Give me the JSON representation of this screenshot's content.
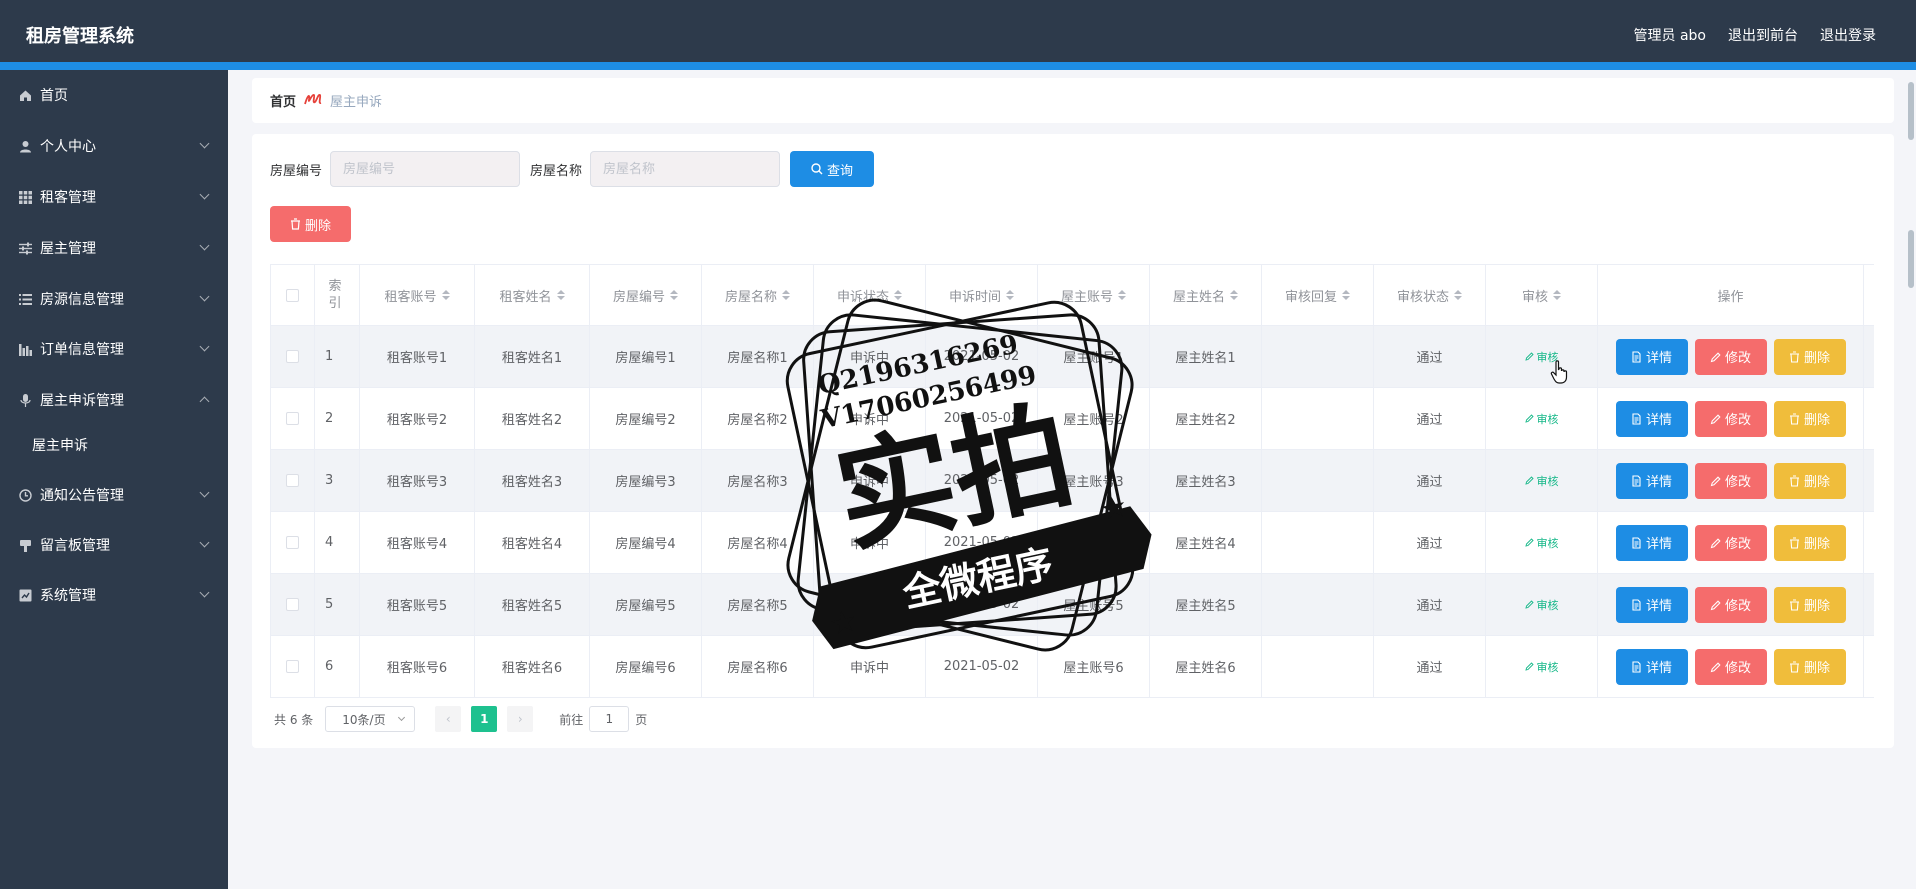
{
  "header": {
    "app_title": "租房管理系统",
    "links": [
      "管理员 abo",
      "退出到前台",
      "退出登录"
    ]
  },
  "sidebar": {
    "items": [
      {
        "label": "首页",
        "icon": "home-icon",
        "expandable": false
      },
      {
        "label": "个人中心",
        "icon": "user-icon",
        "expandable": true
      },
      {
        "label": "租客管理",
        "icon": "grid-icon",
        "expandable": true
      },
      {
        "label": "屋主管理",
        "icon": "sliders-icon",
        "expandable": true
      },
      {
        "label": "房源信息管理",
        "icon": "list-icon",
        "expandable": true
      },
      {
        "label": "订单信息管理",
        "icon": "chart-bar-icon",
        "expandable": true
      },
      {
        "label": "屋主申诉管理",
        "icon": "microphone-icon",
        "expandable": true,
        "expanded": true
      },
      {
        "label": "通知公告管理",
        "icon": "clock-icon",
        "expandable": true
      },
      {
        "label": "留言板管理",
        "icon": "chat-icon",
        "expandable": true
      },
      {
        "label": "系统管理",
        "icon": "settings-box-icon",
        "expandable": true
      }
    ],
    "sub_item": "屋主申诉"
  },
  "breadcrumb": {
    "home": "首页",
    "separator_icon": "scribble-separator-icon",
    "current": "屋主申诉"
  },
  "search": {
    "house_no_label": "房屋编号",
    "house_no_placeholder": "房屋编号",
    "house_name_label": "房屋名称",
    "house_name_placeholder": "房屋名称",
    "query_button": "查询",
    "delete_button": "删除"
  },
  "table": {
    "columns": [
      "",
      "索引",
      "租客账号",
      "租客姓名",
      "房屋编号",
      "房屋名称",
      "申诉状态",
      "申诉时间",
      "屋主账号",
      "屋主姓名",
      "审核回复",
      "审核状态",
      "审核",
      "操作"
    ],
    "rows": [
      {
        "idx": "1",
        "tenant_account": "租客账号1",
        "tenant_name": "租客姓名1",
        "house_no": "房屋编号1",
        "house_name": "房屋名称1",
        "status": "申诉中",
        "time": "2021-05-02",
        "owner_account": "屋主账号1",
        "owner_name": "屋主姓名1",
        "reply": "",
        "audit_status": "通过",
        "audit": "审核"
      },
      {
        "idx": "2",
        "tenant_account": "租客账号2",
        "tenant_name": "租客姓名2",
        "house_no": "房屋编号2",
        "house_name": "房屋名称2",
        "status": "申诉中",
        "time": "2021-05-02",
        "owner_account": "屋主账号2",
        "owner_name": "屋主姓名2",
        "reply": "",
        "audit_status": "通过",
        "audit": "审核"
      },
      {
        "idx": "3",
        "tenant_account": "租客账号3",
        "tenant_name": "租客姓名3",
        "house_no": "房屋编号3",
        "house_name": "房屋名称3",
        "status": "申诉中",
        "time": "2021-05-02",
        "owner_account": "屋主账号3",
        "owner_name": "屋主姓名3",
        "reply": "",
        "audit_status": "通过",
        "audit": "审核"
      },
      {
        "idx": "4",
        "tenant_account": "租客账号4",
        "tenant_name": "租客姓名4",
        "house_no": "房屋编号4",
        "house_name": "房屋名称4",
        "status": "申诉中",
        "time": "2021-05-02",
        "owner_account": "屋主账号4",
        "owner_name": "屋主姓名4",
        "reply": "",
        "audit_status": "通过",
        "audit": "审核"
      },
      {
        "idx": "5",
        "tenant_account": "租客账号5",
        "tenant_name": "租客姓名5",
        "house_no": "房屋编号5",
        "house_name": "房屋名称5",
        "status": "申诉中",
        "time": "2021-05-02",
        "owner_account": "屋主账号5",
        "owner_name": "屋主姓名5",
        "reply": "",
        "audit_status": "通过",
        "audit": "审核"
      },
      {
        "idx": "6",
        "tenant_account": "租客账号6",
        "tenant_name": "租客姓名6",
        "house_no": "房屋编号6",
        "house_name": "房屋名称6",
        "status": "申诉中",
        "time": "2021-05-02",
        "owner_account": "屋主账号6",
        "owner_name": "屋主姓名6",
        "reply": "",
        "audit_status": "通过",
        "audit": "审核"
      }
    ],
    "actions": {
      "detail": "详情",
      "edit": "修改",
      "delete": "删除"
    }
  },
  "pagination": {
    "total": "共 6 条",
    "page_size": "10条/页",
    "current_page": "1",
    "goto_prefix": "前往",
    "goto_value": "1",
    "goto_suffix": "页"
  },
  "watermark": {
    "line1": "Q2196316269",
    "line2": "V17060256499",
    "big_text": "实拍",
    "ribbon_text": "全微程序"
  },
  "colors": {
    "header_bg": "#2d3a4b",
    "accent": "#1e8de4",
    "danger": "#f56c6c",
    "warning": "#f0bd3b",
    "success": "#1ec18f"
  }
}
